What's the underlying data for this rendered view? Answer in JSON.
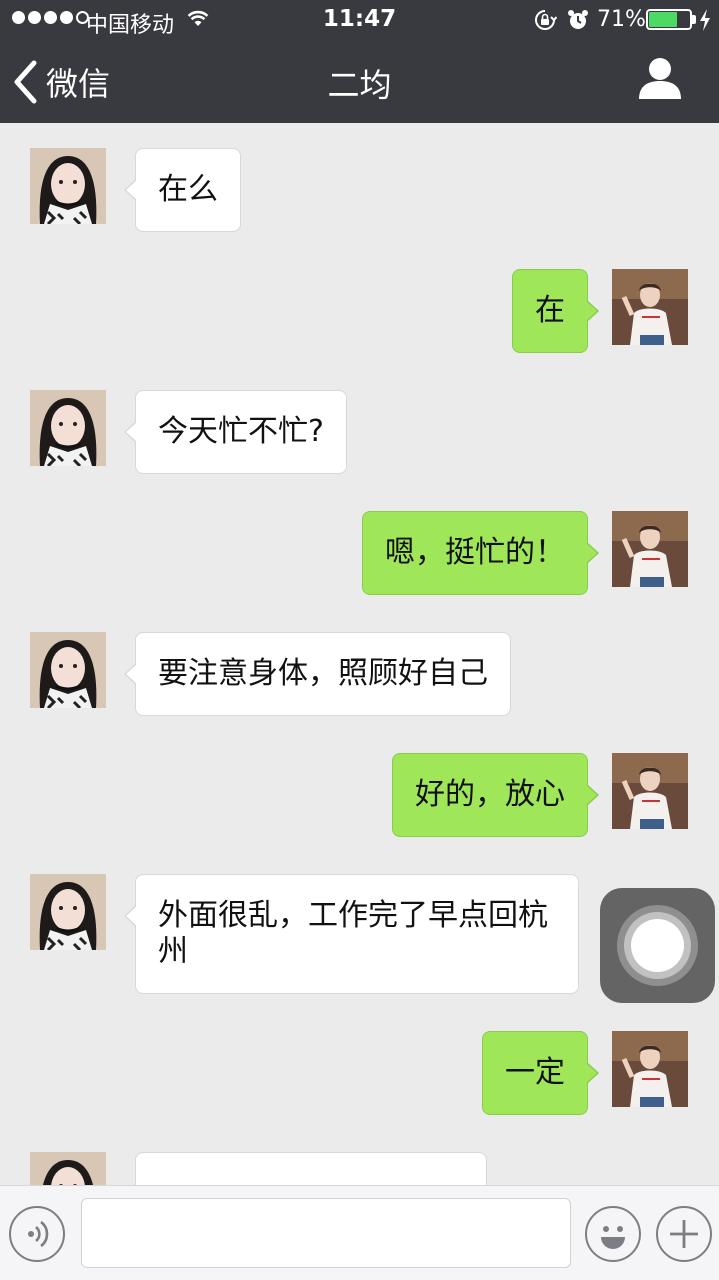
{
  "status_bar": {
    "carrier": "中国移动",
    "time": "11:47",
    "battery": "71%",
    "battery_level": 0.71,
    "icons": [
      "signal-dots-icon",
      "wifi-icon",
      "rotation-lock-icon",
      "alarm-icon",
      "battery-icon",
      "charging-bolt-icon"
    ]
  },
  "nav": {
    "back_label": "微信",
    "title": "二均",
    "back_icon": "chevron-left-icon",
    "contact_icon": "person-icon"
  },
  "messages": [
    {
      "side": "in",
      "text": "在么"
    },
    {
      "side": "out",
      "text": "在"
    },
    {
      "side": "in",
      "text": "今天忙不忙?"
    },
    {
      "side": "out",
      "text": "嗯，挺忙的！"
    },
    {
      "side": "in",
      "text": "要注意身体，照顾好自己"
    },
    {
      "side": "out",
      "text": "好的，放心"
    },
    {
      "side": "in",
      "text": "外面很乱，工作完了早点回杭州"
    },
    {
      "side": "out",
      "text": "一定"
    }
  ],
  "input_bar": {
    "voice_icon": "voice-icon",
    "emoji_icon": "emoji-icon",
    "plus_icon": "plus-icon",
    "input_value": ""
  },
  "colors": {
    "header_bg": "#393a3f",
    "chat_bg": "#ebebeb",
    "outgoing_bubble": "#9fe658",
    "incoming_bubble": "#ffffff",
    "battery_green": "#4cd964"
  }
}
